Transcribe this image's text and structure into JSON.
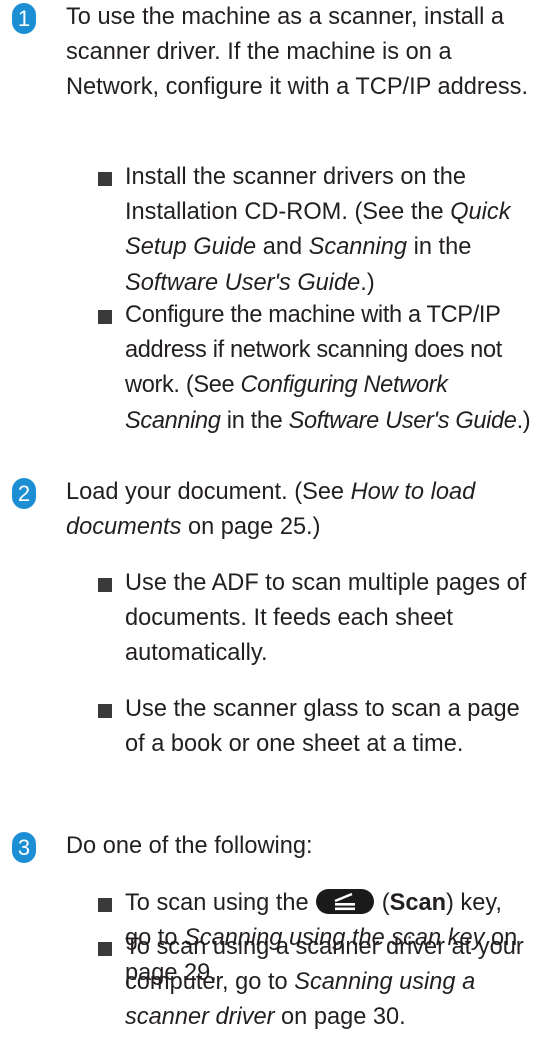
{
  "steps": [
    {
      "number": "1",
      "text": "To use the machine as a scanner, install a scanner driver. If the machine is on a Network, configure it with a TCP/IP address.",
      "bullets": [
        {
          "p1": "Install the scanner drivers on the Installation CD-ROM. (See the ",
          "i1": "Quick Setup Guide",
          "p2": " and ",
          "i2": "Scanning",
          "p3": " in the ",
          "i3": "Software User's Guide",
          "p4": ".)"
        },
        {
          "p1": "Configure the machine with a TCP/IP address if network scanning does not work. (See ",
          "i1": "Configuring Network Scanning",
          "p2": " in the ",
          "i2": "Software User's Guide",
          "p3": ".)"
        }
      ]
    },
    {
      "number": "2",
      "p1": "Load your document. (See ",
      "i1": "How to load documents",
      "p2": " on page 25.)",
      "bullets": [
        {
          "text": "Use the ADF to scan multiple pages of documents. It feeds each sheet automatically."
        },
        {
          "text": "Use the scanner glass to scan a page of a book or one sheet at a time."
        }
      ]
    },
    {
      "number": "3",
      "text": "Do one of the following:",
      "bullets": [
        {
          "p1": "To scan using the ",
          "key_icon": "scan-key-icon",
          "p2": " (",
          "b1": "Scan",
          "p3": ") key, go to ",
          "i1": "Scanning using the scan key",
          "p4": " on page 29."
        },
        {
          "p1": "To scan using a scanner driver at your computer, go to ",
          "i1": "Scanning using a scanner driver",
          "p2": " on page 30."
        }
      ]
    }
  ],
  "colors": {
    "step_badge": "#1c8fd4",
    "bullet": "#3a3a3a",
    "text": "#231f20"
  }
}
